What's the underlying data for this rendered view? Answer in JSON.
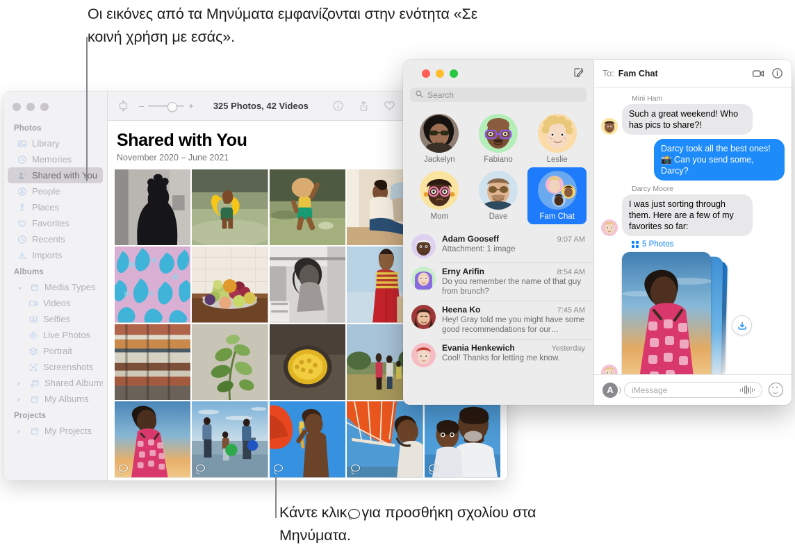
{
  "callouts": {
    "top": "Οι εικόνες από τα Μηνύματα εμφανίζονται στην ενότητα «Σε κοινή χρήση με εσάς».",
    "bottom_part1": "Κάντε κλικ",
    "bottom_part2": "για προσθήκη σχολίου στα Μηνύματα."
  },
  "photos": {
    "window_title": "Photos",
    "sidebar": {
      "sections": [
        {
          "header": "Photos",
          "items": [
            {
              "label": "Library",
              "icon": "library-icon",
              "selected": false
            },
            {
              "label": "Memories",
              "icon": "memories-icon",
              "selected": false
            },
            {
              "label": "Shared with You",
              "icon": "shared-with-you-icon",
              "selected": true
            },
            {
              "label": "People",
              "icon": "people-icon",
              "selected": false
            },
            {
              "label": "Places",
              "icon": "places-icon",
              "selected": false
            },
            {
              "label": "Favorites",
              "icon": "heart-icon",
              "selected": false
            },
            {
              "label": "Recents",
              "icon": "clock-icon",
              "selected": false
            },
            {
              "label": "Imports",
              "icon": "import-icon",
              "selected": false
            }
          ]
        },
        {
          "header": "Albums",
          "items": [
            {
              "label": "Media Types",
              "icon": "folder-icon",
              "twisty": "down",
              "selected": false
            },
            {
              "label": "Videos",
              "icon": "video-icon",
              "indent": true,
              "selected": false
            },
            {
              "label": "Selfies",
              "icon": "selfie-icon",
              "indent": true,
              "selected": false
            },
            {
              "label": "Live Photos",
              "icon": "live-photo-icon",
              "indent": true,
              "selected": false
            },
            {
              "label": "Portrait",
              "icon": "portrait-icon",
              "indent": true,
              "selected": false
            },
            {
              "label": "Screenshots",
              "icon": "screenshot-icon",
              "indent": true,
              "selected": false
            },
            {
              "label": "Shared Albums",
              "icon": "shared-folder-icon",
              "twisty": "right",
              "selected": false
            },
            {
              "label": "My Albums",
              "icon": "folder-icon",
              "twisty": "right",
              "selected": false
            }
          ]
        },
        {
          "header": "Projects",
          "items": [
            {
              "label": "My Projects",
              "icon": "folder-icon",
              "twisty": "right",
              "selected": false
            }
          ]
        }
      ]
    },
    "toolbar": {
      "count_label": "325 Photos, 42 Videos",
      "zoom_minus": "–",
      "zoom_plus": "+",
      "icons": [
        "crop-icon",
        "info-icon",
        "share-icon",
        "heart-icon",
        "rotate-icon"
      ]
    },
    "content": {
      "title": "Shared with You",
      "subtitle": "November 2020 – June 2021",
      "grid": [
        [
          {
            "name": "silhouette-bw",
            "has_comment": false
          },
          {
            "name": "boy-yellow-float",
            "has_comment": false
          },
          {
            "name": "child-jumping-water",
            "has_comment": false
          },
          {
            "name": "man-sitting-studio",
            "has_comment": false
          },
          {
            "name": "hidden-photo-1",
            "has_comment": false
          }
        ],
        [
          {
            "name": "blue-pink-fabric",
            "has_comment": false
          },
          {
            "name": "fruit-bowl",
            "has_comment": false
          },
          {
            "name": "woman-portrait-bw",
            "has_comment": false
          },
          {
            "name": "woman-red-pants",
            "has_comment": false
          },
          {
            "name": "hidden-photo-2",
            "has_comment": false
          }
        ],
        [
          {
            "name": "colorful-stripes",
            "has_comment": false
          },
          {
            "name": "green-leaves",
            "has_comment": false
          },
          {
            "name": "yellow-bowl",
            "has_comment": false
          },
          {
            "name": "family-field",
            "has_comment": false
          },
          {
            "name": "hidden-photo-3",
            "has_comment": false
          }
        ],
        [
          {
            "name": "woman-sunset-pink",
            "has_comment": true
          },
          {
            "name": "family-beach",
            "has_comment": true
          },
          {
            "name": "boy-orange-umbrella",
            "has_comment": true
          },
          {
            "name": "man-orange-kite",
            "has_comment": true
          },
          {
            "name": "father-and-son",
            "has_comment": true
          }
        ]
      ]
    }
  },
  "messages": {
    "search": {
      "placeholder": "Search",
      "icon": "search-icon"
    },
    "compose_icon": "compose-icon",
    "contacts": [
      {
        "name": "Jackelyn",
        "avatar": "photo-woman-sunglasses",
        "selected": false
      },
      {
        "name": "Fabiano",
        "avatar": "memoji-man-purple-glasses",
        "selected": false
      },
      {
        "name": "Leslie",
        "avatar": "memoji-blonde-curly",
        "selected": false
      },
      {
        "name": "Mom",
        "avatar": "memoji-pink-glasses",
        "selected": false
      },
      {
        "name": "Dave",
        "avatar": "photo-man-sunglasses",
        "selected": false
      },
      {
        "name": "Fam Chat",
        "avatar": "group-avatar",
        "selected": true
      }
    ],
    "conversations": [
      {
        "name": "Adam Gooseff",
        "time": "9:07 AM",
        "preview": "Attachment: 1 image",
        "avatar": "memoji-man-white-cap"
      },
      {
        "name": "Erny Arifin",
        "time": "8:54 AM",
        "preview": "Do you remember the name of that guy from brunch?",
        "avatar": "memoji-hijab"
      },
      {
        "name": "Heena Ko",
        "time": "7:45 AM",
        "preview": "Hey! Gray told me you might have some good recommendations for our…",
        "avatar": "photo-woman-smiling"
      },
      {
        "name": "Evania Henkewich",
        "time": "Yesterday",
        "preview": "Cool! Thanks for letting me know.",
        "avatar": "memoji-red-hair"
      }
    ],
    "thread": {
      "to_label": "To:",
      "to_value": "Fam Chat",
      "header_icons": [
        "video-call-icon",
        "info-icon"
      ],
      "bubbles": [
        {
          "sender": "Mini Ham",
          "text": "Such a great weekend! Who has pics to share?!",
          "direction": "in",
          "avatar": "memoji-mini-ham"
        },
        {
          "sender": "",
          "text": "Darcy took all the best ones! 📸 Can you send some, Darcy?",
          "direction": "out",
          "avatar": ""
        },
        {
          "sender": "Darcy Moore",
          "text": "I was just sorting through them. Here are a few of my favorites so far:",
          "direction": "in",
          "avatar": "memoji-darcy"
        }
      ],
      "attachment": {
        "badge_label": "5 Photos",
        "badge_icon": "grid-icon",
        "download_icon": "download-icon",
        "avatar": "memoji-darcy",
        "photo": "woman-sunset-pink"
      }
    },
    "input_bar": {
      "appstore_icon": "appstore-icon",
      "placeholder": "iMessage",
      "audio_icon": "audio-waveform-icon",
      "emoji_icon": "emoji-icon"
    }
  },
  "colors": {
    "accent_blue": "#1e8bfb",
    "selected_blue": "#1e7bfb",
    "link_blue": "#0a84ff",
    "sidebar_bg": "#f2f1f3",
    "messages_bg": "#ececec"
  }
}
